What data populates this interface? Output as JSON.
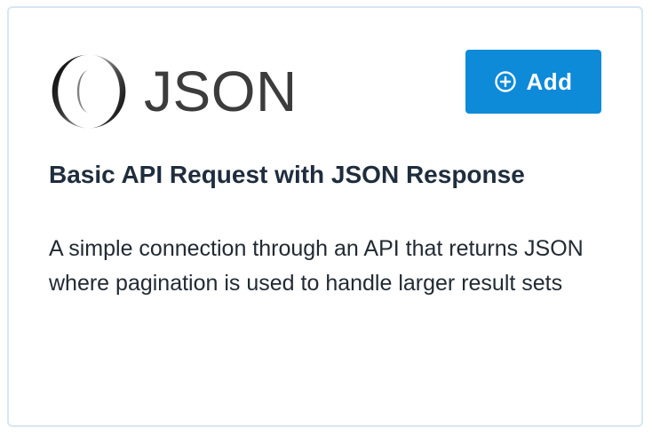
{
  "card": {
    "logo_text": "JSON",
    "add_button_label": "Add",
    "title": "Basic API Request with JSON Response",
    "description": "A simple connection through an API that returns JSON where pagination is used to handle larger result sets",
    "icons": {
      "logo": "json-logo-icon",
      "add": "plus-circle-icon"
    },
    "colors": {
      "accent": "#0d8ad8",
      "border": "#d7e7f3",
      "title": "#1f2d3d"
    }
  }
}
